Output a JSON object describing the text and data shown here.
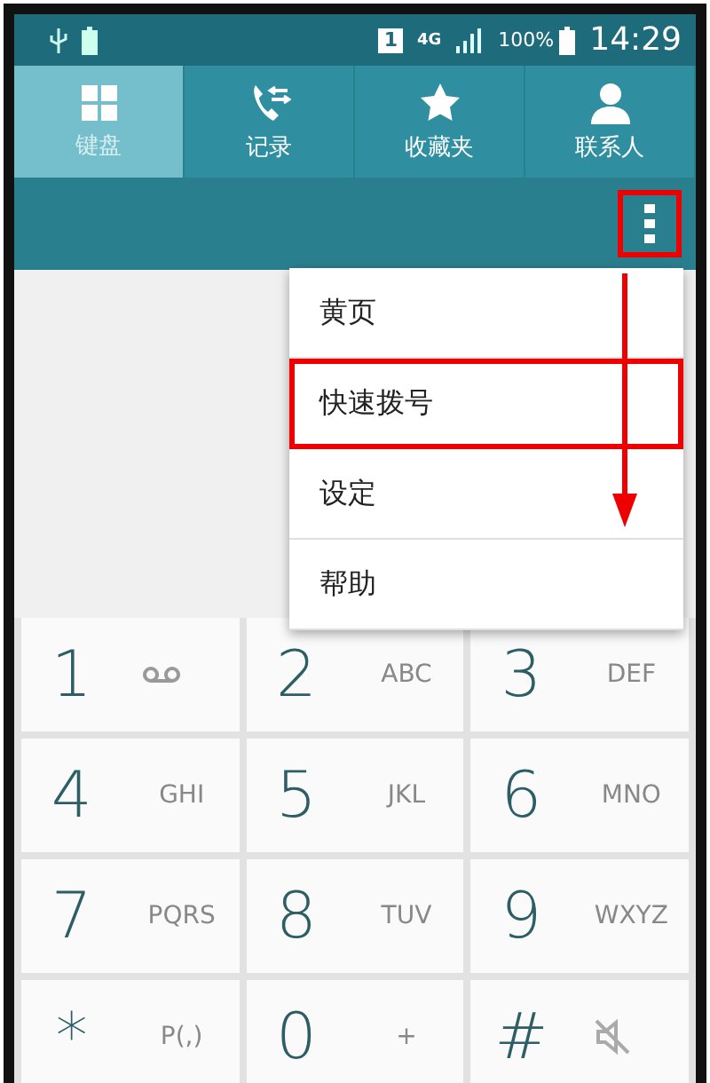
{
  "status_bar": {
    "sim": "1",
    "network": "4G",
    "battery": "100%",
    "time": "14:29"
  },
  "tabs": [
    {
      "label": "键盘",
      "kind": "keypad",
      "selected": true
    },
    {
      "label": "记录",
      "kind": "log",
      "selected": false
    },
    {
      "label": "收藏夹",
      "kind": "star",
      "selected": false
    },
    {
      "label": "联系人",
      "kind": "person",
      "selected": false
    }
  ],
  "menu": {
    "highlighted_overflow": true,
    "items": [
      {
        "label": "黄页",
        "highlighted": false
      },
      {
        "label": "快速拨号",
        "highlighted": true
      },
      {
        "label": "设定",
        "highlighted": false
      },
      {
        "label": "帮助",
        "highlighted": false
      }
    ]
  },
  "keypad": [
    {
      "digit": "1",
      "kind": "voicemail"
    },
    {
      "digit": "2",
      "kind": "letters",
      "letters": "ABC"
    },
    {
      "digit": "3",
      "kind": "letters",
      "letters": "DEF"
    },
    {
      "digit": "4",
      "kind": "letters",
      "letters": "GHI"
    },
    {
      "digit": "5",
      "kind": "letters",
      "letters": "JKL"
    },
    {
      "digit": "6",
      "kind": "letters",
      "letters": "MNO"
    },
    {
      "digit": "7",
      "kind": "letters",
      "letters": "PQRS"
    },
    {
      "digit": "8",
      "kind": "letters",
      "letters": "TUV"
    },
    {
      "digit": "9",
      "kind": "letters",
      "letters": "WXYZ"
    },
    {
      "digit": "*",
      "kind": "letters",
      "letters": "P(,)"
    },
    {
      "digit": "0",
      "kind": "letters",
      "letters": "+"
    },
    {
      "digit": "#",
      "kind": "mute"
    }
  ]
}
